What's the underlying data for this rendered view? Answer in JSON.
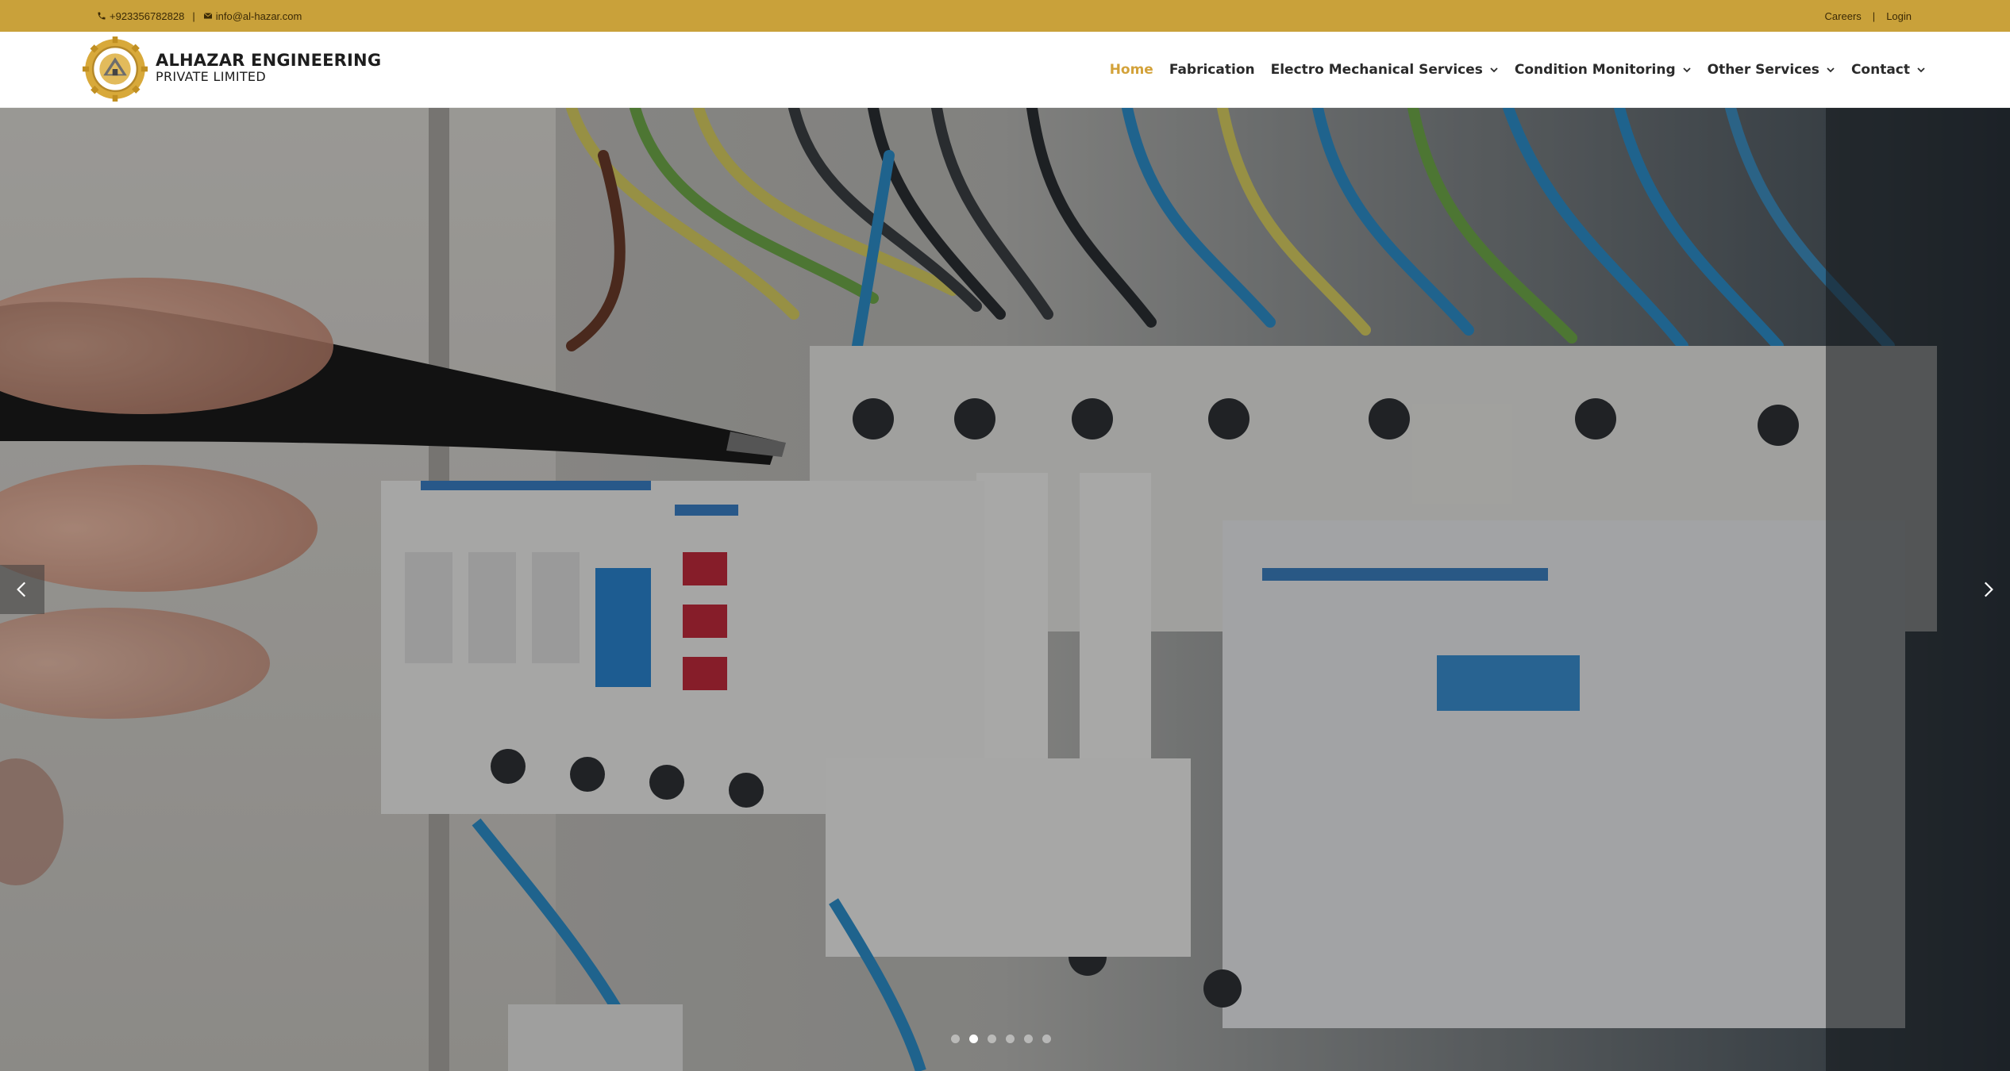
{
  "topbar": {
    "phone": "+923356782828",
    "separator": "|",
    "email": "info@al-hazar.com",
    "careers": "Careers",
    "right_separator": "|",
    "login": "Login"
  },
  "brand": {
    "name": "ALHAZAR ENGINEERING",
    "sub": "PRIVATE LIMITED"
  },
  "nav": {
    "items": [
      {
        "label": "Home",
        "active": true
      },
      {
        "label": "Fabrication"
      },
      {
        "label": "Electro Mechanical Services",
        "dropdown": true
      },
      {
        "label": "Condition Monitoring",
        "dropdown": true
      },
      {
        "label": "Other Services",
        "dropdown": true
      },
      {
        "label": "Contact",
        "dropdown": true
      }
    ]
  },
  "slider": {
    "slide_count": 6,
    "active_index": 1,
    "icons": {
      "prev": "chevron-left-icon",
      "next": "chevron-right-icon"
    }
  },
  "colors": {
    "topbar": "#c9a13a",
    "accent": "#d3a23a",
    "nav_text": "#2a2a2a"
  }
}
